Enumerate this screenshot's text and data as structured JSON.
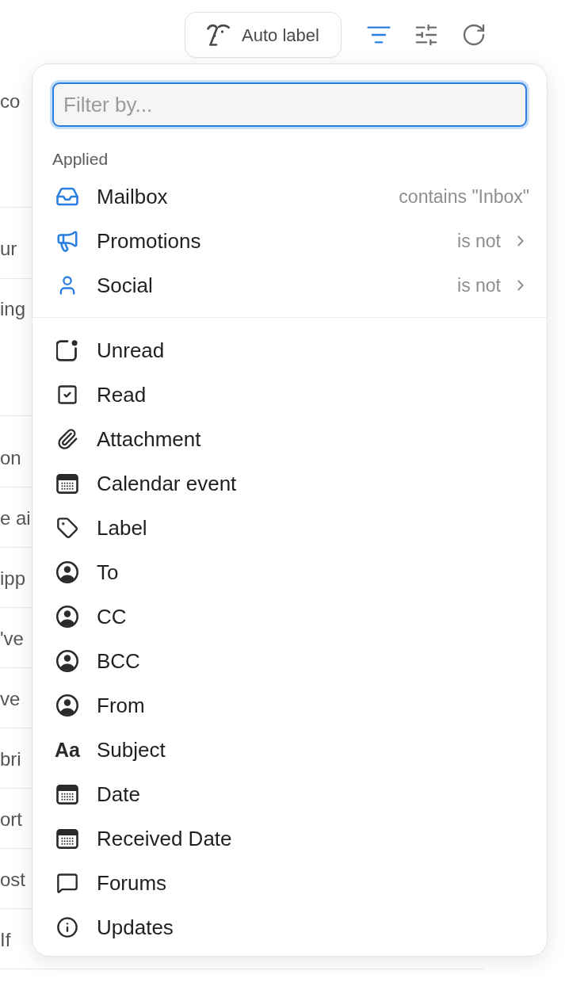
{
  "toolbar": {
    "auto_label_button": "Auto label",
    "icon_buttons": [
      {
        "active": true
      },
      {
        "active": false
      },
      {
        "active": false
      }
    ]
  },
  "email_list": {
    "rows": [
      {
        "text": "co"
      },
      {
        "text": "ur"
      },
      {
        "text": "ing"
      },
      {
        "text": "on"
      },
      {
        "text": "e ai"
      },
      {
        "text": "ipp"
      },
      {
        "text": "'ve"
      },
      {
        "text": "ve"
      },
      {
        "text": "bri"
      },
      {
        "text": "ort"
      },
      {
        "text": "ost"
      },
      {
        "text": "If"
      }
    ]
  },
  "filter_menu": {
    "search": {
      "placeholder": "Filter by..."
    },
    "applied_heading": "Applied",
    "applied": [
      {
        "label": "Mailbox",
        "condition": "contains \"Inbox\"",
        "has_submenu": false
      },
      {
        "label": "Promotions",
        "condition": "is not",
        "has_submenu": true
      },
      {
        "label": "Social",
        "condition": "is not",
        "has_submenu": true
      }
    ],
    "options": [
      {
        "label": "Unread"
      },
      {
        "label": "Read"
      },
      {
        "label": "Attachment"
      },
      {
        "label": "Calendar event"
      },
      {
        "label": "Label"
      },
      {
        "label": "To"
      },
      {
        "label": "CC"
      },
      {
        "label": "BCC"
      },
      {
        "label": "From"
      },
      {
        "label": "Subject",
        "glyph": "Aa"
      },
      {
        "label": "Date"
      },
      {
        "label": "Received Date"
      },
      {
        "label": "Forums"
      },
      {
        "label": "Updates"
      }
    ]
  }
}
